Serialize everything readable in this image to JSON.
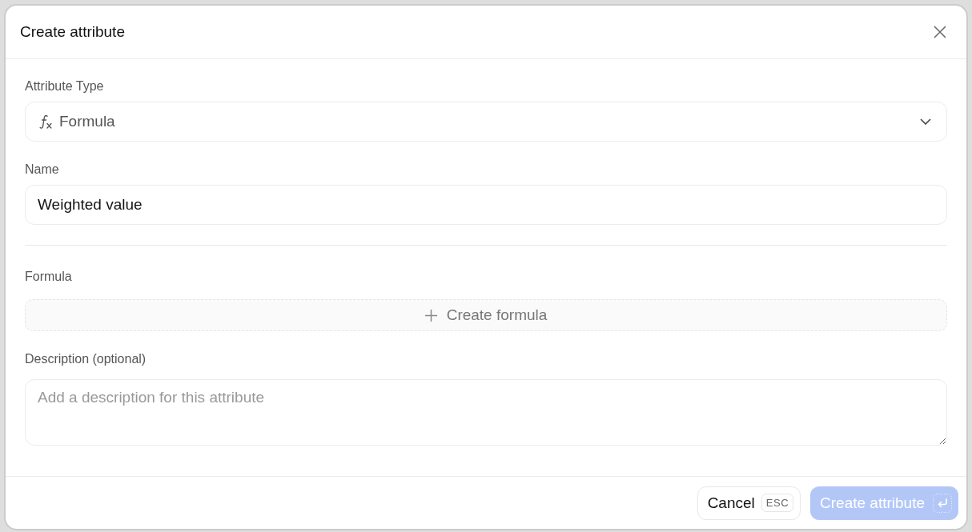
{
  "dialog": {
    "title": "Create attribute",
    "sections": [
      {
        "fields": [
          {
            "kind": "select",
            "label": "Attribute Type",
            "value": "Formula"
          },
          {
            "kind": "text",
            "label": "Name",
            "value": "Weighted value"
          }
        ]
      },
      {
        "fields": [
          {
            "kind": "action",
            "label": "Formula",
            "button_label": "Create formula"
          },
          {
            "kind": "textarea",
            "label": "Description (optional)",
            "placeholder": "Add a description for this attribute"
          }
        ]
      }
    ],
    "actions": [
      {
        "kind": "secondary",
        "label": "Cancel",
        "shortcut": "ESC",
        "disabled": false
      },
      {
        "kind": "primary",
        "label": "Create attribute",
        "disabled": true
      }
    ]
  }
}
